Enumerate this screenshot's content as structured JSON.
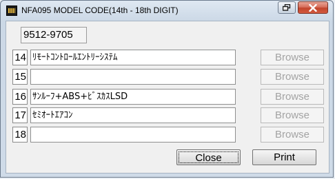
{
  "window": {
    "title": "NFA095 MODEL CODE(14th - 18th DIGIT)",
    "icon": "app-icon"
  },
  "model_code": "9512-9705",
  "rows": [
    {
      "digit": "14",
      "value": "ﾘﾓｰﾄｺﾝﾄﾛｰﾙｴﾝﾄﾘｰｼｽﾃﾑ",
      "browse_label": "Browse"
    },
    {
      "digit": "15",
      "value": "",
      "browse_label": "Browse"
    },
    {
      "digit": "16",
      "value": "ｻﾝﾙｰﾌ+ABS+ﾋﾞｽｶｽLSD",
      "browse_label": "Browse"
    },
    {
      "digit": "17",
      "value": "ｾﾐｵｰﾄｴｱｺﾝ",
      "browse_label": "Browse"
    },
    {
      "digit": "18",
      "value": "",
      "browse_label": "Browse"
    }
  ],
  "buttons": {
    "close_label": "Close",
    "print_label": "Print"
  },
  "colors": {
    "close_caption": "#c2452c",
    "disabled_text": "#a3a3a3"
  }
}
